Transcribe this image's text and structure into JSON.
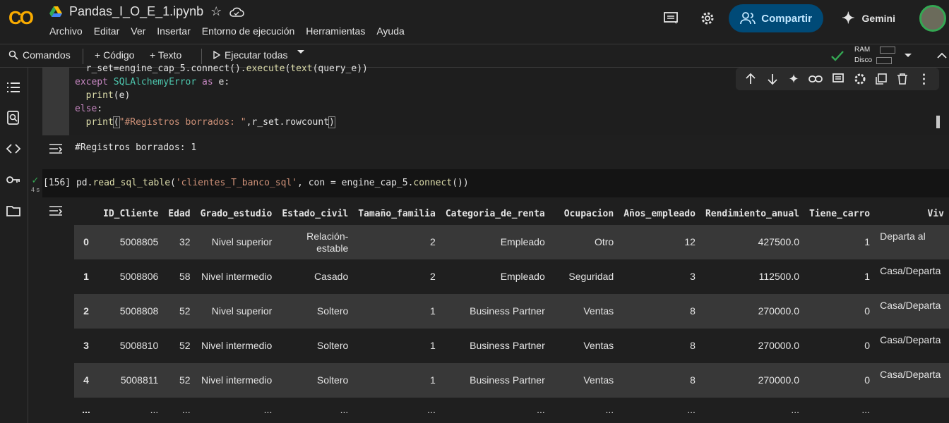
{
  "app": {
    "file_name": "Pandas_I_O_E_1.ipynb",
    "menu": [
      "Archivo",
      "Editar",
      "Ver",
      "Insertar",
      "Entorno de ejecución",
      "Herramientas",
      "Ayuda"
    ],
    "share_label": "Compartir",
    "gemini_label": "Gemini"
  },
  "toolbar": {
    "commands_label": "Comandos",
    "code_label": "+ Código",
    "text_label": "+ Texto",
    "run_all_label": "Ejecutar todas",
    "ram_label": "RAM",
    "disk_label": "Disco"
  },
  "cell1": {
    "lines": [
      "  r_set=engine_cap_5.connect().execute(text(query_e))",
      "except SQLAlchemyError as e:",
      "  print(e)",
      "else:",
      "  print(\"#Registros borrados: \",r_set.rowcount)"
    ],
    "output": "#Registros borrados:  1"
  },
  "cell2": {
    "exec_count": "[156]",
    "exec_time": "4 s",
    "code": "pd.read_sql_table('clientes_T_banco_sql', con = engine_cap_5.connect())"
  },
  "dataframe": {
    "columns": [
      "",
      "ID_Cliente",
      "Edad",
      "Grado_estudio",
      "Estado_civil",
      "Tamaño_familia",
      "Categoria_de_renta",
      "Ocupacion",
      "Años_empleado",
      "Rendimiento_anual",
      "Tiene_carro",
      "Viv"
    ],
    "rows": [
      [
        "0",
        "5008805",
        "32",
        "Nivel superior",
        "Relación-estable",
        "2",
        "Empleado",
        "Otro",
        "12",
        "427500.0",
        "1",
        "Departa al"
      ],
      [
        "1",
        "5008806",
        "58",
        "Nivel intermedio",
        "Casado",
        "2",
        "Empleado",
        "Seguridad",
        "3",
        "112500.0",
        "1",
        "Casa/Departa"
      ],
      [
        "2",
        "5008808",
        "52",
        "Nivel superior",
        "Soltero",
        "1",
        "Business Partner",
        "Ventas",
        "8",
        "270000.0",
        "0",
        "Casa/Departa"
      ],
      [
        "3",
        "5008810",
        "52",
        "Nivel intermedio",
        "Soltero",
        "1",
        "Business Partner",
        "Ventas",
        "8",
        "270000.0",
        "0",
        "Casa/Departa"
      ],
      [
        "4",
        "5008811",
        "52",
        "Nivel intermedio",
        "Soltero",
        "1",
        "Business Partner",
        "Ventas",
        "8",
        "270000.0",
        "0",
        "Casa/Departa"
      ],
      [
        "...",
        "...",
        "...",
        "...",
        "...",
        "...",
        "...",
        "...",
        "...",
        "...",
        "...",
        ""
      ]
    ]
  },
  "icons": [
    "colab-logo",
    "drive-icon",
    "star-icon",
    "cloud-icon",
    "comment-icon",
    "gear-icon",
    "people-icon",
    "gemini-icon",
    "search-icon",
    "play-icon",
    "check-icon",
    "chevron-down-icon",
    "arrow-up-icon",
    "arrow-down-icon",
    "sparkle-icon",
    "link-icon",
    "comment-icon",
    "gear-icon",
    "mirror-icon",
    "trash-icon",
    "more-icon",
    "toc-icon",
    "find-icon",
    "code-icon",
    "key-icon",
    "folder-icon",
    "output-icon"
  ],
  "colors": {
    "accent": "#004a77",
    "logo": "#f9ab00",
    "check": "#34a853"
  }
}
